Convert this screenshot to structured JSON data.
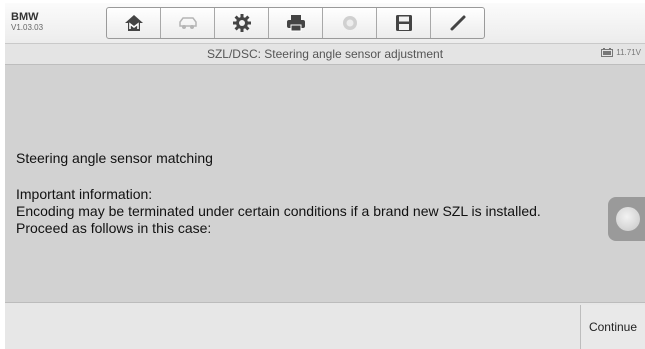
{
  "app": {
    "name": "BMW",
    "version": "V1.03.03"
  },
  "toolbar": {
    "tools": [
      "home-icon",
      "vehicle-icon",
      "gear-icon",
      "printer-icon",
      "help-icon",
      "save-icon",
      "pen-icon"
    ]
  },
  "titlebar": {
    "title": "SZL/DSC: Steering angle sensor adjustment",
    "voltage": "11.71V"
  },
  "content": {
    "line1": "Steering angle sensor matching",
    "line2": "Important information:",
    "line3": "Encoding may be terminated under certain conditions if a brand new SZL is installed.",
    "line4": "Proceed as follows in this case:"
  },
  "bottombar": {
    "continue_label": "Continue"
  }
}
